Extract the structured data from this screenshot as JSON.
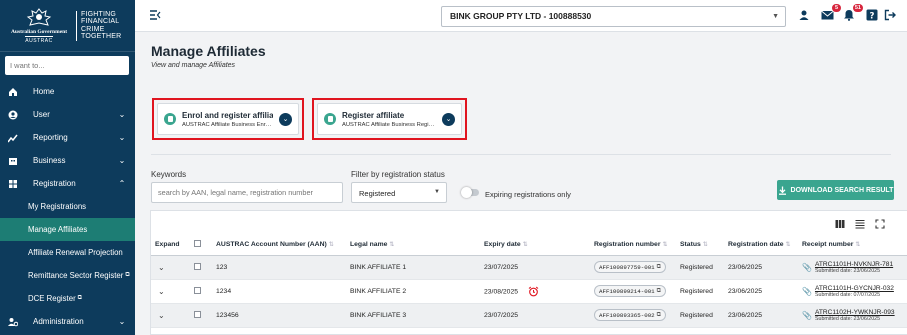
{
  "brand": {
    "gov_name": "Australian Government",
    "gov_agency": "AUSTRAC",
    "campaign_lines": [
      "FIGHTING",
      "FINANCIAL",
      "CRIME",
      "TOGETHER"
    ]
  },
  "sidebar": {
    "search_placeholder": "I want to...",
    "items": [
      {
        "label": "Home",
        "icon": "home-icon"
      },
      {
        "label": "User",
        "icon": "user-icon",
        "chevron": "down"
      },
      {
        "label": "Reporting",
        "icon": "reporting-icon",
        "chevron": "down"
      },
      {
        "label": "Business",
        "icon": "business-icon",
        "chevron": "down"
      },
      {
        "label": "Registration",
        "icon": "registration-icon",
        "chevron": "up"
      }
    ],
    "registration_sub": [
      {
        "label": "My Registrations",
        "active": false
      },
      {
        "label": "Manage Affiliates",
        "active": true
      },
      {
        "label": "Affiliate Renewal Projection",
        "active": false
      },
      {
        "label": "Remittance Sector Register",
        "external": true
      },
      {
        "label": "DCE Register",
        "external": true
      }
    ],
    "administration": {
      "label": "Administration",
      "icon": "administration-icon",
      "chevron": "down"
    }
  },
  "topbar": {
    "org_selected": "BINK GROUP PTY LTD - 100888530",
    "mail_count": "5",
    "notification_count": "51"
  },
  "page": {
    "title": "Manage Affiliates",
    "subtitle": "View and manage Affiliates"
  },
  "actions": [
    {
      "title": "Enrol and register affiliate",
      "subtitle": "AUSTRAC Affiliate Business Enrolment and Registration"
    },
    {
      "title": "Register affiliate",
      "subtitle": "AUSTRAC Affiliate Business Registration"
    }
  ],
  "filters": {
    "keywords_label": "Keywords",
    "keywords_placeholder": "search by AAN, legal name, registration number",
    "status_label": "Filter by registration status",
    "status_value": "Registered",
    "expiring_label": "Expiring registrations only",
    "download_label": "DOWNLOAD SEARCH RESULT"
  },
  "table": {
    "columns": [
      "Expand",
      "",
      "AUSTRAC Account Number (AAN)",
      "Legal name",
      "Expiry date",
      "Registration number",
      "Status",
      "Registration date",
      "Receipt number"
    ],
    "rows": [
      {
        "aan": "123",
        "name": "BINK AFFILIATE 1",
        "expiry": "23/07/2025",
        "alarm": false,
        "reg": "AFF100897759-001",
        "status": "Registered",
        "reg_date": "23/06/2025",
        "receipt": "ATRC1101H-NVKNJR-781",
        "submitted": "Submitted date: 23/06/2025"
      },
      {
        "aan": "1234",
        "name": "BINK AFFILIATE 2",
        "expiry": "23/08/2025",
        "alarm": true,
        "reg": "AFF100899214-001",
        "status": "Registered",
        "reg_date": "23/06/2025",
        "receipt": "ATRC1101H-GYCNJR-032",
        "submitted": "Submitted date: 07/07/2025"
      },
      {
        "aan": "123456",
        "name": "BINK AFFILIATE 3",
        "expiry": "23/07/2025",
        "alarm": false,
        "reg": "AFF100893365-002",
        "status": "Registered",
        "reg_date": "23/06/2025",
        "receipt": "ATRC1102H-YWKNJR-093",
        "submitted": "Submitted date: 23/06/2025"
      }
    ]
  }
}
